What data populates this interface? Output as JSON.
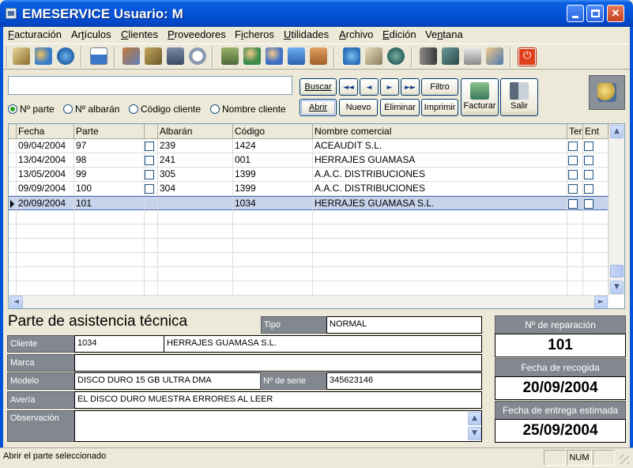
{
  "window": {
    "title": "EMESERVICE Usuario: M",
    "controls": {
      "minimize": "min",
      "maximize": "max",
      "close": "✕"
    }
  },
  "menu": [
    {
      "u": "F",
      "rest": "acturación"
    },
    {
      "pre": "Ar",
      "u": "t",
      "rest": "ículos"
    },
    {
      "u": "C",
      "rest": "lientes"
    },
    {
      "u": "P",
      "rest": "roveedores"
    },
    {
      "pre": "F",
      "u": "i",
      "rest": "cheros"
    },
    {
      "u": "U",
      "rest": "tilidades"
    },
    {
      "u": "A",
      "rest": "rchivo"
    },
    {
      "u": "E",
      "rest": "dición"
    },
    {
      "pre": "Ve",
      "u": "n",
      "rest": "tana"
    }
  ],
  "toolbar": {
    "icons": [
      "box-icon",
      "users-icon",
      "globe-icon",
      "home-icon",
      "contacts-icon",
      "factory-icon",
      "calculator-icon",
      "clock-icon",
      "register-icon",
      "person-icon",
      "people-icon",
      "monitor-icon",
      "briefcase-icon",
      "world-icon",
      "package-icon",
      "globe-settings-icon",
      "tools-icon",
      "notebook-icon",
      "printer-icon",
      "mail-icon",
      "power-icon"
    ]
  },
  "search": {
    "value": "",
    "placeholder": "",
    "radios": [
      {
        "label": "Nº parte",
        "checked": true
      },
      {
        "label": "Nº albarán",
        "checked": false
      },
      {
        "label": "Código cliente",
        "checked": false
      },
      {
        "label": "Nombre cliente",
        "checked": false
      }
    ]
  },
  "buttons": {
    "buscar": "Buscar",
    "first": "◄◄",
    "prev": "◄",
    "next": "►",
    "last": "►►",
    "filtro": "Filtro",
    "abrir": "Abrir",
    "nuevo": "Nuevo",
    "eliminar": "Eliminar",
    "imprimir": "Imprimir",
    "facturar": "Facturar",
    "salir": "Salir"
  },
  "grid": {
    "columns": {
      "fecha": "Fecha",
      "parte": "Parte",
      "albaran": "Albarán",
      "codigo": "Código",
      "nombre": "Nombre comercial",
      "ter": "Ter",
      "ent": "Ent"
    },
    "rows": [
      {
        "fecha": "09/04/2004",
        "parte": "97",
        "albaran": "239",
        "codigo": "1424",
        "nombre": "ACEAUDIT S.L."
      },
      {
        "fecha": "13/04/2004",
        "parte": "98",
        "albaran": "241",
        "codigo": "001",
        "nombre": "HERRAJES GUAMASA"
      },
      {
        "fecha": "13/05/2004",
        "parte": "99",
        "albaran": "305",
        "codigo": "1399",
        "nombre": "A.A.C. DISTRIBUCIONES"
      },
      {
        "fecha": "09/09/2004",
        "parte": "100",
        "albaran": "304",
        "codigo": "1399",
        "nombre": "A.A.C. DISTRIBUCIONES"
      },
      {
        "fecha": "20/09/2004",
        "parte": "101",
        "albaran": "",
        "codigo": "1034",
        "nombre": "HERRAJES GUAMASA S.L.",
        "selected": true
      }
    ]
  },
  "form": {
    "title": "Parte de asistencia técnica",
    "tipo_label": "Tipo",
    "tipo_value": "NORMAL",
    "cliente_label": "Cliente",
    "cliente_code": "1034",
    "cliente_name": "HERRAJES GUAMASA S.L.",
    "marca_label": "Marca",
    "marca_value": "",
    "modelo_label": "Modelo",
    "modelo_value": "DISCO DURO 15 GB ULTRA DMA",
    "serie_label": "Nº de serie",
    "serie_value": "345623146",
    "averia_label": "Avería",
    "averia_value": "EL DISCO DURO MUESTRA ERRORES AL LEER",
    "observacion_label": "Observación",
    "observacion_value": ""
  },
  "side": {
    "reparacion_label": "Nº de reparación",
    "reparacion_value": "101",
    "recogida_label": "Fecha de recogida",
    "recogida_value": "20/09/2004",
    "entrega_label": "Fecha de entrega estimada",
    "entrega_value": "25/09/2004"
  },
  "status": {
    "text": "Abrir el parte seleccionado",
    "num": "NUM"
  }
}
